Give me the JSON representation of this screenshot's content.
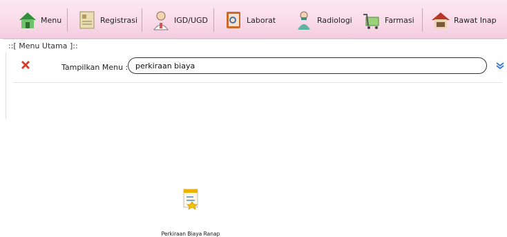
{
  "toolbar": {
    "items": [
      {
        "label": "Menu",
        "icon": "house-icon"
      },
      {
        "label": "Registrasi",
        "icon": "registration-document-icon"
      },
      {
        "label": "IGD/UGD",
        "icon": "emergency-doctor-icon"
      },
      {
        "label": "Laborat",
        "icon": "laboratory-book-icon"
      },
      {
        "label": "Radiologi",
        "icon": "radiology-staff-icon"
      },
      {
        "label": "Farmasi",
        "icon": "pharmacy-cart-icon"
      },
      {
        "label": "Rawat Inap",
        "icon": "inpatient-house-icon"
      }
    ]
  },
  "main_menu": {
    "title": "::[ Menu Utama ]::",
    "show_label": "Tampilkan Menu :",
    "search_value": "perkiraan biaya"
  },
  "results": [
    {
      "label": "Perkiraan Biaya Ranap",
      "icon": "cost-estimate-icon"
    }
  ],
  "colors": {
    "toolbar_bg": "#f9dbe9",
    "accent_red": "#d63b2a"
  }
}
